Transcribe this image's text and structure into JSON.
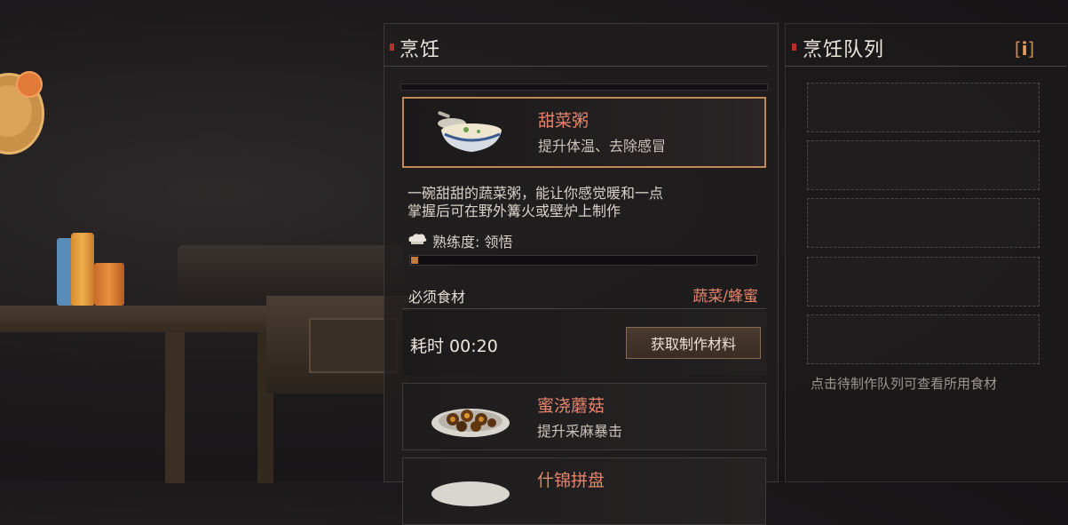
{
  "cooking_panel": {
    "title": "烹饪",
    "selected_recipe": {
      "name": "甜菜粥",
      "effect": "提升体温、去除感冒",
      "description_line1": "一碗甜甜的蔬菜粥，能让你感觉暖和一点",
      "description_line2": "掌握后可在野外篝火或壁炉上制作",
      "proficiency_label": "熟练度: 领悟",
      "proficiency_progress": 0.02,
      "ingredients_label": "必须食材",
      "ingredients_value": "蔬菜/蜂蜜",
      "time_label": "耗时 00:20",
      "fetch_button": "获取制作材料"
    },
    "recipes": [
      {
        "name": "蜜浇蘑菇",
        "effect": "提升采麻暴击"
      },
      {
        "name": "什锦拼盘",
        "effect": ""
      }
    ]
  },
  "queue_panel": {
    "title": "烹饪队列",
    "info_button": "i",
    "hint": "点击待制作队列可查看所用食材",
    "slot_count": 5
  },
  "colors": {
    "accent_orange": "#e7846c",
    "selected_border": "#c08a55",
    "header_mark": "#b8302c"
  }
}
